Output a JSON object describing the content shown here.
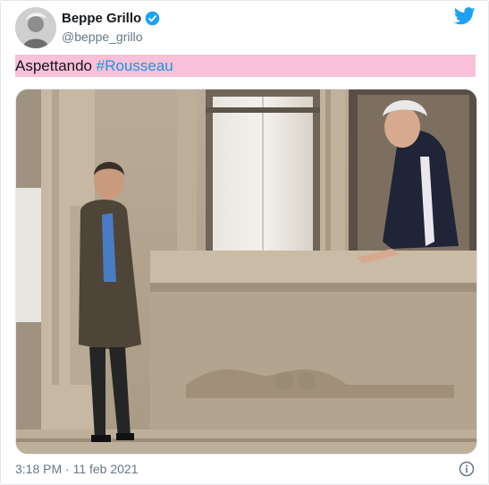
{
  "author": {
    "name": "Beppe Grillo",
    "handle": "@beppe_grillo"
  },
  "tweet": {
    "text_plain": "Aspettando ",
    "hashtag": "#Rousseau"
  },
  "footer": {
    "timestamp": "3:18 PM · 11 feb 2021"
  },
  "icons": {
    "verified": "verified-badge-icon",
    "logo": "twitter-bird-icon",
    "info": "info-icon"
  },
  "colors": {
    "highlight": "#f9c0d9",
    "hashtag": "#1b95e0",
    "brand": "#1da1f2"
  }
}
